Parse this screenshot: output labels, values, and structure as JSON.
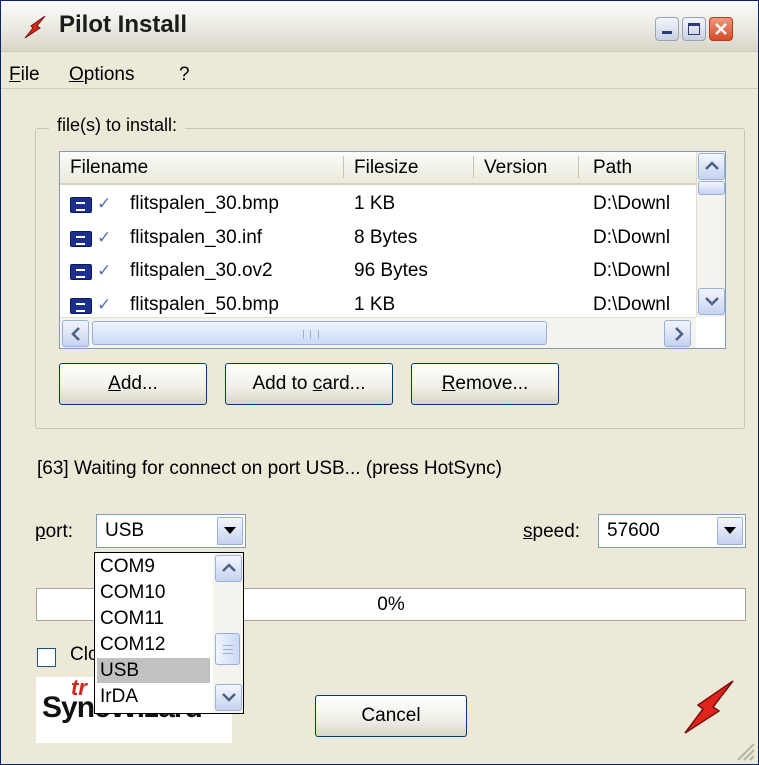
{
  "window": {
    "title": "Pilot Install",
    "accent": "#d42a1e",
    "controls": {
      "minimize_icon": "minimize-icon",
      "maximize_icon": "maximize-icon",
      "close_icon": "close-icon"
    }
  },
  "menu": {
    "items": [
      {
        "label": "ile",
        "access_key": "F"
      },
      {
        "label": "ptions",
        "access_key": "O"
      },
      {
        "label": "?",
        "access_key": ""
      }
    ]
  },
  "files_group": {
    "label": "file(s) to install:",
    "columns": [
      "Filename",
      "Filesize",
      "Version",
      "Path"
    ],
    "rows": [
      {
        "filename": "flitspalen_30.bmp",
        "filesize": "1 KB",
        "version": "",
        "path": "D:\\Downl"
      },
      {
        "filename": "flitspalen_30.inf",
        "filesize": "8 Bytes",
        "version": "",
        "path": "D:\\Downl"
      },
      {
        "filename": "flitspalen_30.ov2",
        "filesize": "96 Bytes",
        "version": "",
        "path": "D:\\Downl"
      },
      {
        "filename": "flitspalen_50.bmp",
        "filesize": "1 KB",
        "version": "",
        "path": "D:\\Downl"
      }
    ],
    "buttons": {
      "add": {
        "pre": "",
        "key": "A",
        "post": "dd..."
      },
      "add_to_card": {
        "pre": "Add to ",
        "key": "c",
        "post": "ard..."
      },
      "remove": {
        "pre": "",
        "key": "R",
        "post": "emove..."
      }
    }
  },
  "status": {
    "text": "[63] Waiting for connect on port USB... (press HotSync)"
  },
  "port": {
    "label_key": "p",
    "label_rest": "ort:",
    "value": "USB",
    "options": [
      "COM9",
      "COM10",
      "COM11",
      "COM12",
      "USB",
      "IrDA"
    ],
    "selected": "USB"
  },
  "speed": {
    "label_key": "s",
    "label_rest": "peed:",
    "value": "57600"
  },
  "progress": {
    "value": 0,
    "text": "0%"
  },
  "close_option": {
    "label": "Clo",
    "checked": false
  },
  "logo": {
    "prefix": "tr",
    "name": "SyncWizard"
  },
  "cancel": {
    "label": "Cancel"
  },
  "brand_icon": "hotsync-icon"
}
